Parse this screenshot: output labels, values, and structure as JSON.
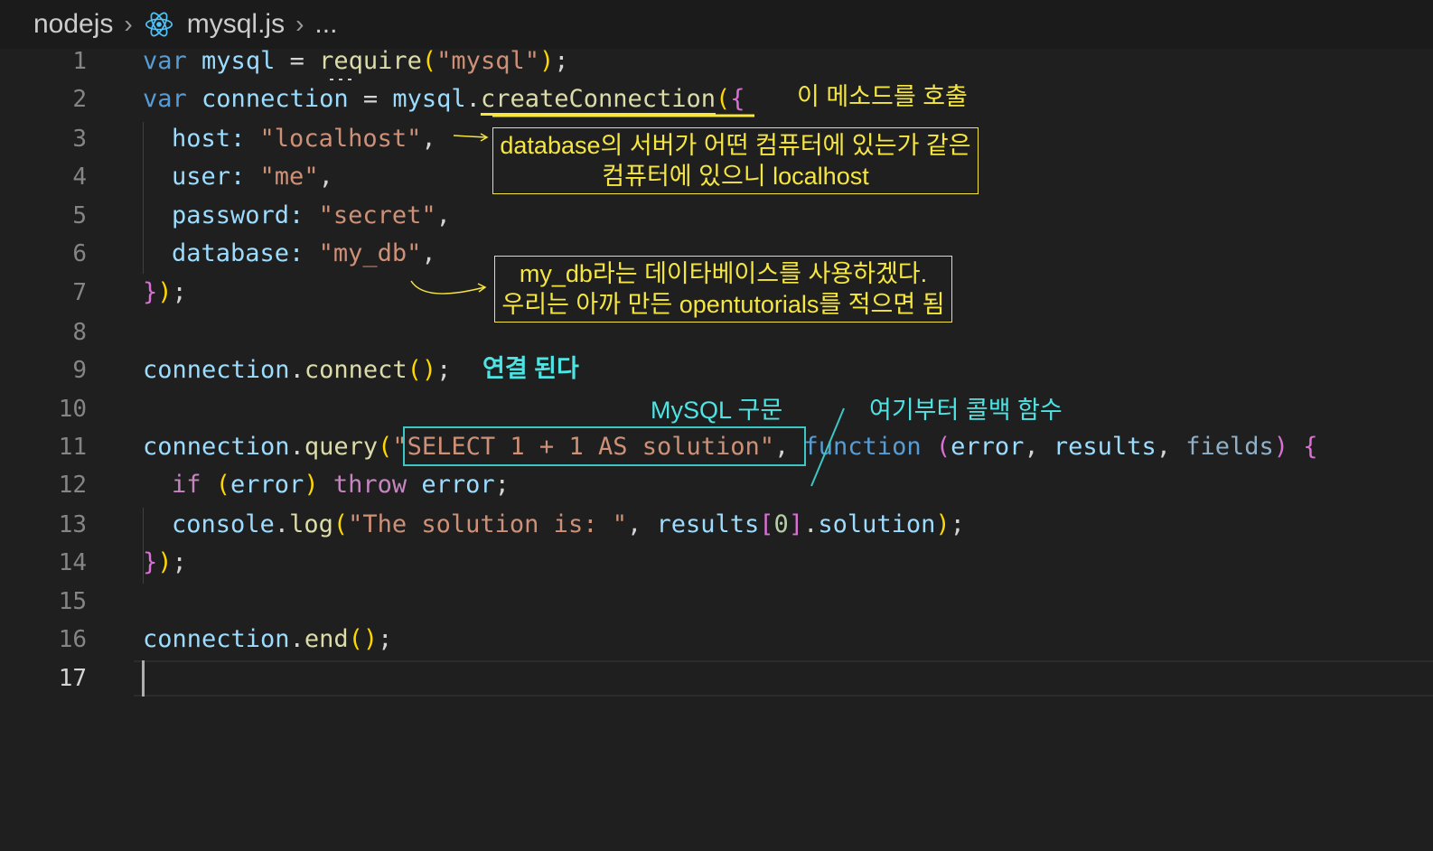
{
  "breadcrumb": {
    "folder": "nodejs",
    "file": "mysql.js",
    "more": "..."
  },
  "colors": {
    "annotation_yellow": "#f5e642",
    "annotation_cyan": "#4ee4e4"
  },
  "lines": [
    {
      "n": "1"
    },
    {
      "n": "2"
    },
    {
      "n": "3"
    },
    {
      "n": "4"
    },
    {
      "n": "5"
    },
    {
      "n": "6"
    },
    {
      "n": "7"
    },
    {
      "n": "8"
    },
    {
      "n": "9"
    },
    {
      "n": "10"
    },
    {
      "n": "11"
    },
    {
      "n": "12"
    },
    {
      "n": "13"
    },
    {
      "n": "14"
    },
    {
      "n": "15"
    },
    {
      "n": "16"
    },
    {
      "n": "17"
    }
  ],
  "code": {
    "l1": {
      "kw": "var",
      "id": "mysql",
      "eq": " = ",
      "fn": "require",
      "o": "(",
      "str": "\"mysql\"",
      "c": ")",
      "end": ";"
    },
    "l2": {
      "kw": "var",
      "id": "connection",
      "eq": " = ",
      "obj": "mysql",
      "dot": ".",
      "fn": "createConnection",
      "o": "(",
      "br": "{"
    },
    "l3": {
      "key": "host",
      "col": ": ",
      "str": "\"localhost\"",
      "end": ","
    },
    "l4": {
      "key": "user",
      "col": ": ",
      "str": "\"me\"",
      "end": ","
    },
    "l5": {
      "key": "password",
      "col": ": ",
      "str": "\"secret\"",
      "end": ","
    },
    "l6": {
      "key": "database",
      "col": ": ",
      "str": "\"my_db\"",
      "end": ","
    },
    "l7": {
      "br": "}",
      "c": ")",
      "end": ";"
    },
    "l9": {
      "obj": "connection",
      "dot": ".",
      "fn": "connect",
      "o": "(",
      "c": ")",
      "end": ";"
    },
    "l11": {
      "obj": "connection",
      "dot": ".",
      "fn": "query",
      "o": "(",
      "str": "\"SELECT 1 + 1 AS solution\"",
      "comma": ", ",
      "kw": "function",
      "p1": "(",
      "a1": "error",
      "s1": ", ",
      "a2": "results",
      "s2": ", ",
      "a3": "fields",
      "p2": ")",
      "br": " {"
    },
    "l12": {
      "kw": "if",
      "p1": " (",
      "id": "error",
      "p2": ") ",
      "kw2": "throw",
      "id2": " error",
      "end": ";"
    },
    "l13": {
      "obj": "console",
      "dot": ".",
      "fn": "log",
      "o": "(",
      "str": "\"The solution is: \"",
      "comma": ", ",
      "id": "results",
      "b1": "[",
      "num": "0",
      "b2": "]",
      "dot2": ".",
      "prop": "solution",
      "c": ")",
      "end": ";"
    },
    "l14": {
      "br": "}",
      "c": ")",
      "end": ";"
    },
    "l16": {
      "obj": "connection",
      "dot": ".",
      "fn": "end",
      "o": "(",
      "c": ")",
      "end": ";"
    }
  },
  "annotations": {
    "call_method": "이 메소드를 호출",
    "host_note_1": "database의 서버가 어떤 컴퓨터에 있는가 같은",
    "host_note_2": "컴퓨터에 있으니 localhost",
    "db_note_1": "my_db라는 데이타베이스를 사용하겠다.",
    "db_note_2": "우리는 아까 만든 opentutorials를 적으면 됨",
    "connected": "연결 된다",
    "mysql_syntax": "MySQL 구문",
    "callback": "여기부터 콜백 함수"
  }
}
